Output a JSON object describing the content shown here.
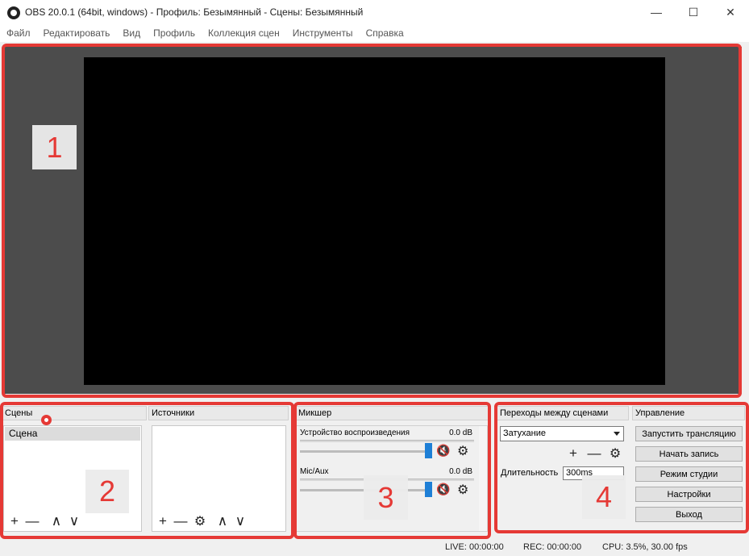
{
  "window": {
    "title": "OBS 20.0.1 (64bit, windows) - Профиль: Безымянный - Сцены: Безымянный",
    "minimize_glyph": "—",
    "maximize_glyph": "☐",
    "close_glyph": "✕"
  },
  "menu": [
    "Файл",
    "Редактировать",
    "Вид",
    "Профиль",
    "Коллекция сцен",
    "Инструменты",
    "Справка"
  ],
  "annotations": [
    "1",
    "2",
    "3",
    "4"
  ],
  "scenes": {
    "header": "Сцены",
    "items": [
      "Сцена"
    ]
  },
  "sources": {
    "header": "Источники"
  },
  "mixer": {
    "header": "Микшер",
    "channels": [
      {
        "name": "Устройство воспроизведения",
        "db": "0.0 dB"
      },
      {
        "name": "Mic/Aux",
        "db": "0.0 dB"
      }
    ]
  },
  "transitions": {
    "header": "Переходы между сценами",
    "selected": "Затухание",
    "duration_label": "Длительность",
    "duration_value": "300ms"
  },
  "controls": {
    "header": "Управление",
    "buttons": [
      "Запустить трансляцию",
      "Начать запись",
      "Режим студии",
      "Настройки",
      "Выход"
    ]
  },
  "status": {
    "live": "LIVE: 00:00:00",
    "rec": "REC: 00:00:00",
    "cpu": "CPU: 3.5%, 30.00 fps"
  },
  "icons": {
    "add": "+",
    "remove": "—",
    "up": "∧",
    "down": "∨",
    "gear": "⚙",
    "mute": "🔇"
  },
  "colors": {
    "annotation_red": "#e53935",
    "slider_blue": "#1e7fd6",
    "preview_bg": "#4c4c4c",
    "canvas_bg": "#000000"
  }
}
